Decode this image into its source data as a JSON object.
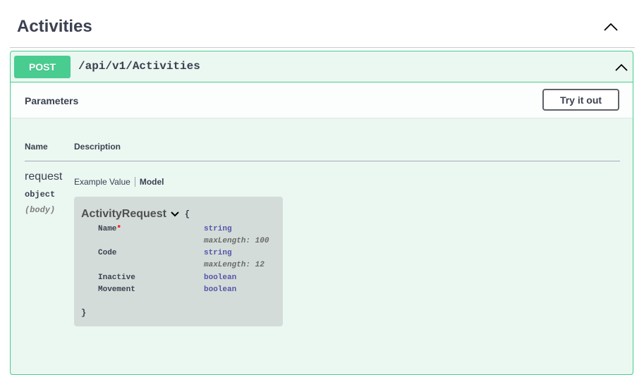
{
  "tag": {
    "title": "Activities",
    "toggle_icon": "chevron-up-icon"
  },
  "operation": {
    "method": "POST",
    "path": "/api/v1/Activities",
    "method_color": "#49cc90",
    "toggle_icon": "chevron-up-icon"
  },
  "parameters": {
    "title": "Parameters",
    "try_label": "Try it out",
    "columns": {
      "name": "Name",
      "description": "Description"
    },
    "param": {
      "name": "request",
      "type": "object",
      "in": "(body)"
    }
  },
  "model_tabs": {
    "example": "Example Value",
    "model": "Model"
  },
  "model": {
    "name": "ActivityRequest",
    "open_brace": "{",
    "close_brace": "}",
    "required_mark": "*",
    "properties": [
      {
        "name": "Name",
        "type": "string",
        "meta": "maxLength: 100",
        "required": true
      },
      {
        "name": "Code",
        "type": "string",
        "meta": "maxLength: 12",
        "required": false
      },
      {
        "name": "Inactive",
        "type": "boolean",
        "meta": "",
        "required": false
      },
      {
        "name": "Movement",
        "type": "boolean",
        "meta": "",
        "required": false
      }
    ]
  }
}
